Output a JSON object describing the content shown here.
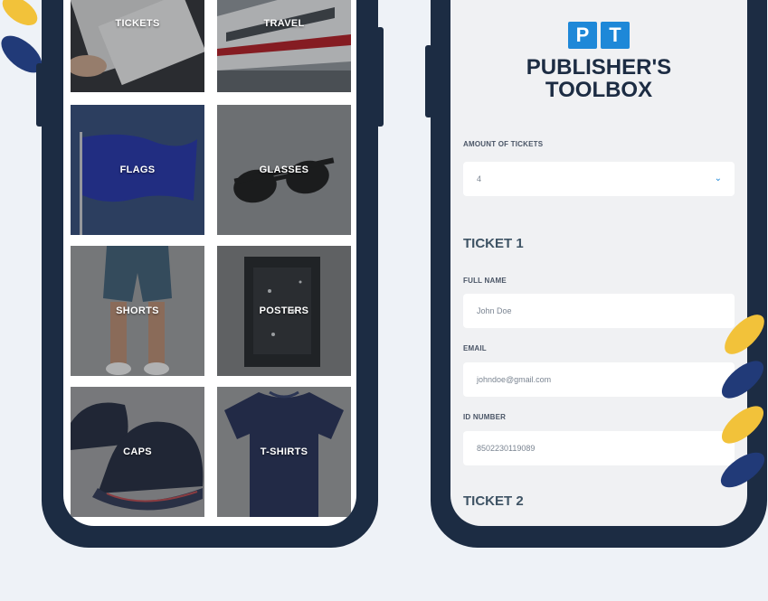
{
  "colors": {
    "background": "#eef2f7",
    "phone_frame": "#1c2c43",
    "accent_blue": "#1e88d8",
    "leaf_yellow": "#f2c23a",
    "leaf_navy": "#213a78"
  },
  "catalog": {
    "tiles": [
      {
        "label": "TICKETS"
      },
      {
        "label": "TRAVEL"
      },
      {
        "label": "FLAGS"
      },
      {
        "label": "GLASSES"
      },
      {
        "label": "SHORTS"
      },
      {
        "label": "POSTERS"
      },
      {
        "label": "CAPS"
      },
      {
        "label": "T-SHIRTS"
      }
    ]
  },
  "form": {
    "logo": {
      "letter1": "P",
      "letter2": "T",
      "line1": "PUBLISHER'S",
      "line2": "TOOLBOX"
    },
    "amount": {
      "label": "AMOUNT OF TICKETS",
      "value": "4"
    },
    "ticket1": {
      "title": "TICKET 1",
      "full_name": {
        "label": "FULL NAME",
        "value": "John Doe"
      },
      "email": {
        "label": "EMAIL",
        "value": "johndoe@gmail.com"
      },
      "id_number": {
        "label": "ID NUMBER",
        "value": "8502230119089"
      }
    },
    "ticket2": {
      "title": "TICKET 2"
    }
  }
}
